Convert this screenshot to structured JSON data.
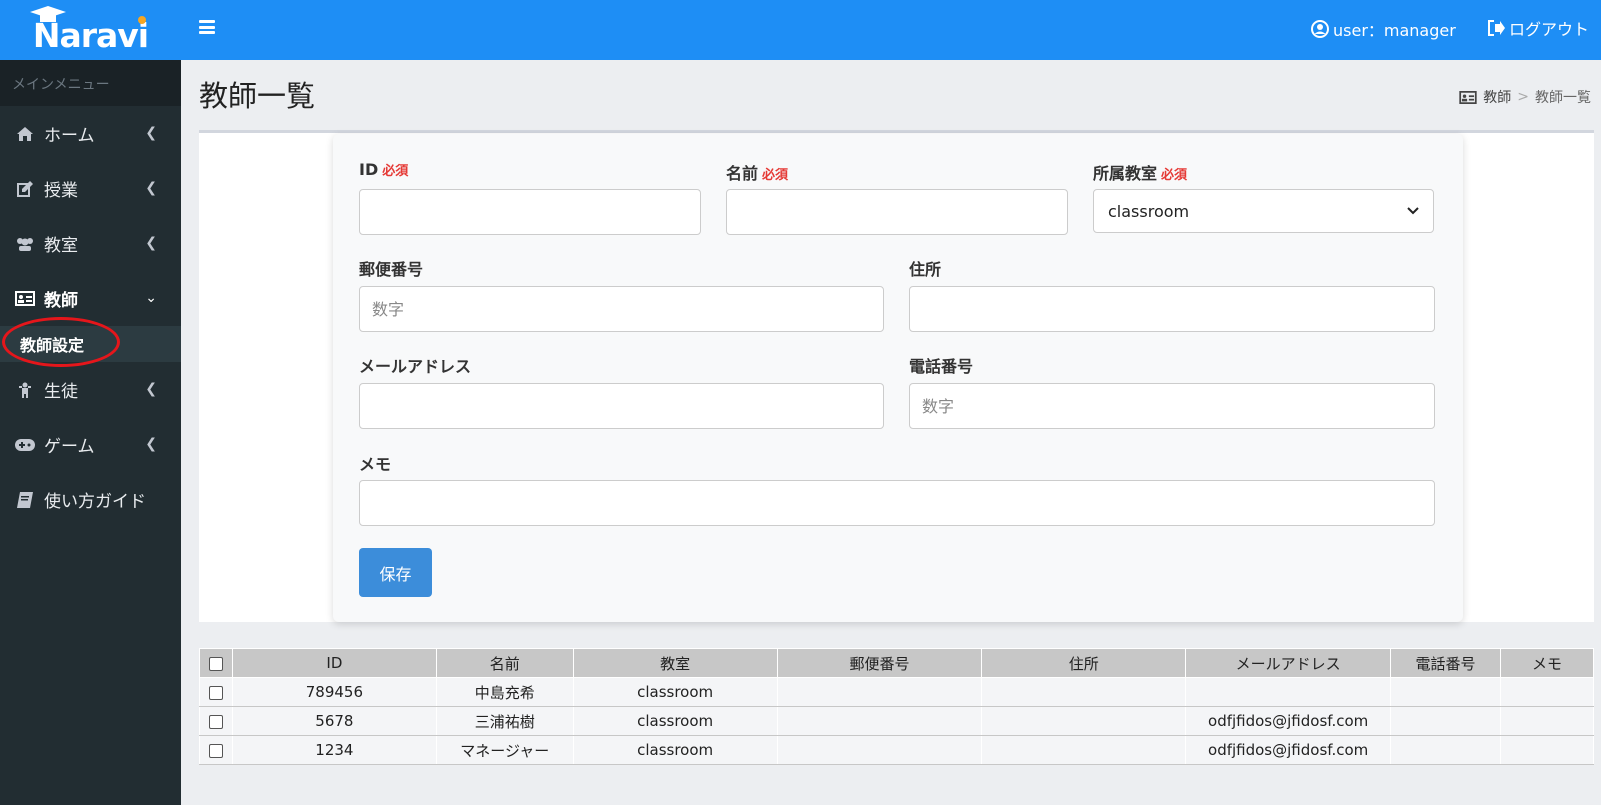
{
  "app": {
    "logo": "Naravi"
  },
  "sidebar": {
    "header": "メインメニュー",
    "items": [
      {
        "label": "ホーム",
        "icon": "home-icon"
      },
      {
        "label": "授業",
        "icon": "edit-icon"
      },
      {
        "label": "教室",
        "icon": "users-icon"
      },
      {
        "label": "教師",
        "icon": "id-card-icon",
        "open": true
      },
      {
        "label": "生徒",
        "icon": "child-icon"
      },
      {
        "label": "ゲーム",
        "icon": "gamepad-icon"
      },
      {
        "label": "使い方ガイド",
        "icon": "book-icon"
      }
    ],
    "sub_item": "教師設定"
  },
  "topbar": {
    "user": "user：manager",
    "logout": "ログアウト"
  },
  "page": {
    "title": "教師一覧"
  },
  "breadcrumb": {
    "parent": "教師",
    "separator": ">",
    "current": "教師一覧"
  },
  "form": {
    "id_label": "ID",
    "name_label": "名前",
    "classroom_label": "所属教室",
    "required": "必須",
    "classroom_value": "classroom",
    "postal_label": "郵便番号",
    "postal_placeholder": "数字",
    "address_label": "住所",
    "email_label": "メールアドレス",
    "phone_label": "電話番号",
    "phone_placeholder": "数字",
    "memo_label": "メモ",
    "save_label": "保存"
  },
  "table": {
    "headers": [
      "ID",
      "名前",
      "教室",
      "郵便番号",
      "住所",
      "メールアドレス",
      "電話番号",
      "メモ"
    ],
    "rows": [
      [
        "789456",
        "中島充希",
        "classroom",
        "",
        "",
        "",
        "",
        ""
      ],
      [
        "5678",
        "三浦祐樹",
        "classroom",
        "",
        "",
        "odfjfidos@jfidosf.com",
        "",
        ""
      ],
      [
        "1234",
        "マネージャー",
        "classroom",
        "",
        "",
        "odfjfidos@jfidosf.com",
        "",
        ""
      ]
    ]
  },
  "colors": {
    "primary": "#1e8ef5",
    "sidebar": "#222d32",
    "required": "#e53935",
    "annotation": "#e5161b",
    "button": "#3c8dda"
  }
}
